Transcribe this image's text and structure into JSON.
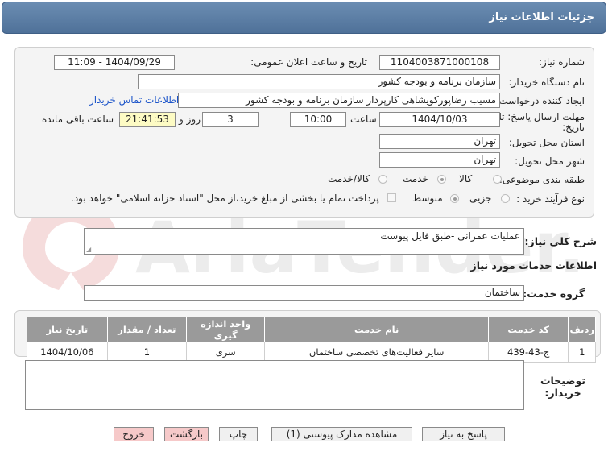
{
  "header": {
    "title": "جزئیات اطلاعات نیاز"
  },
  "form": {
    "need_number_label": "شماره نیاز:",
    "need_number": "1104003871000108",
    "announce_label": "تاریخ و ساعت اعلان عمومی:",
    "announce_value": "1404/09/29 - 11:09",
    "buyer_org_label": "نام دستگاه خریدار:",
    "buyer_org": "سازمان برنامه و بودجه کشور",
    "creator_label": "ایجاد کننده درخواست:",
    "creator": "مسیب رضاپورکویشاهی کارپرداز سازمان برنامه و بودجه کشور",
    "contact_link": "اطلاعات تماس خریدار",
    "deadline_label_1": "مهلت ارسال پاسخ: تا",
    "deadline_label_2": "تاریخ:",
    "deadline_date": "1404/10/03",
    "time_label": "ساعت",
    "deadline_time": "10:00",
    "days_value": "3",
    "days_label": "روز و",
    "remaining_time": "21:41:53",
    "remaining_label": "ساعت باقی مانده",
    "province_label": "استان محل تحویل:",
    "province": "تهران",
    "city_label": "شهر محل تحویل:",
    "city": "تهران",
    "category_label": "طبقه بندی موضوعی:",
    "category_options": [
      "کالا",
      "خدمت",
      "کالا/خدمت"
    ],
    "category_selected": "خدمت",
    "process_label": "نوع فرآیند خرید :",
    "process_options": [
      "جزیی",
      "متوسط"
    ],
    "process_selected": "متوسط",
    "payment_note": "پرداخت تمام یا بخشی از مبلغ خرید،از محل \"اسناد خزانه اسلامی\" خواهد بود."
  },
  "summary": {
    "label": "شرح کلی نیاز:",
    "value": "عملیات عمرانی -طبق فایل پیوست"
  },
  "services": {
    "section_title": "اطلاعات خدمات مورد نیاز",
    "group_label": "گروه خدمت:",
    "group_value": "ساختمان",
    "columns": [
      "ردیف",
      "کد خدمت",
      "نام خدمت",
      "واحد اندازه گیری",
      "تعداد / مقدار",
      "تاریخ نیاز"
    ],
    "rows": [
      [
        "1",
        "ج-43-439",
        "سایر فعالیت‌های تخصصی ساختمان",
        "سری",
        "1",
        "1404/10/06"
      ]
    ]
  },
  "notes": {
    "label": "توضیحات خریدار:"
  },
  "buttons": {
    "reply": "پاسخ به نیاز",
    "view_docs": "مشاهده مدارک پیوستی (1)",
    "print": "چاپ",
    "back": "بازگشت",
    "exit": "خروج"
  },
  "watermark": {
    "text": "AriaTender.neT"
  },
  "colors": {
    "header": "#5a7ca4",
    "accent_link": "#1a53c9",
    "yellow_field": "#fdfbc4",
    "table_header": "#9a9a9a"
  }
}
